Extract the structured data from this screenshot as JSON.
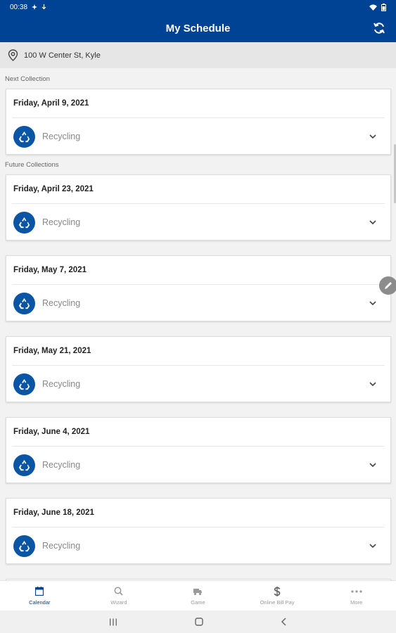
{
  "status": {
    "time": "00:38"
  },
  "header": {
    "title": "My Schedule"
  },
  "address": {
    "text": "100 W Center St, Kyle"
  },
  "sections": {
    "next": "Next Collection",
    "future": "Future Collections"
  },
  "collections": [
    {
      "date": "Friday, April 9, 2021",
      "type": "Recycling"
    },
    {
      "date": "Friday, April 23, 2021",
      "type": "Recycling"
    },
    {
      "date": "Friday, May 7, 2021",
      "type": "Recycling"
    },
    {
      "date": "Friday, May 21, 2021",
      "type": "Recycling"
    },
    {
      "date": "Friday, June 4, 2021",
      "type": "Recycling"
    },
    {
      "date": "Friday, June 18, 2021",
      "type": "Recycling"
    }
  ],
  "bottom_nav": [
    {
      "label": "Calendar",
      "icon": "calendar-icon",
      "active": true
    },
    {
      "label": "Wizard",
      "icon": "search-icon",
      "active": false
    },
    {
      "label": "Game",
      "icon": "truck-icon",
      "active": false
    },
    {
      "label": "Online Bill Pay",
      "icon": "dollar-icon",
      "active": false
    },
    {
      "label": "More",
      "icon": "more-icon",
      "active": false
    }
  ],
  "colors": {
    "brand": "#004293",
    "badge": "#0a56a5",
    "background": "#f2f2f2"
  }
}
